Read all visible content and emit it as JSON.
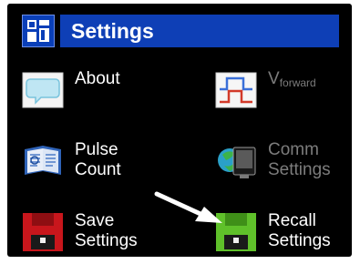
{
  "header": {
    "title": "Settings",
    "logo_icon": "app-logo-icon"
  },
  "items": [
    {
      "id": "about",
      "icon": "speech-bubble-icon",
      "line1": "About",
      "line2": "",
      "enabled": true
    },
    {
      "id": "vforward",
      "icon": "pulse-waveform-icon",
      "line1": "V",
      "sub": "forward",
      "line2": "",
      "enabled": false
    },
    {
      "id": "pulse-count",
      "icon": "book-icon",
      "line1": "Pulse",
      "line2": "Count",
      "enabled": true
    },
    {
      "id": "comm-settings",
      "icon": "computer-monitor-icon",
      "line1": "Comm",
      "line2": "Settings",
      "enabled": false
    },
    {
      "id": "save-settings",
      "icon": "red-floppy-disk-icon",
      "line1": "Save",
      "line2": "Settings",
      "enabled": true
    },
    {
      "id": "recall-settings",
      "icon": "green-floppy-disk-icon",
      "line1": "Recall",
      "line2": "Settings",
      "enabled": true
    }
  ],
  "colors": {
    "title_bar": "#0e3fb6",
    "enabled_text": "#ffffff",
    "disabled_text": "#7c7c7c",
    "save_disk": "#c8161c",
    "recall_disk": "#5fc02a"
  }
}
